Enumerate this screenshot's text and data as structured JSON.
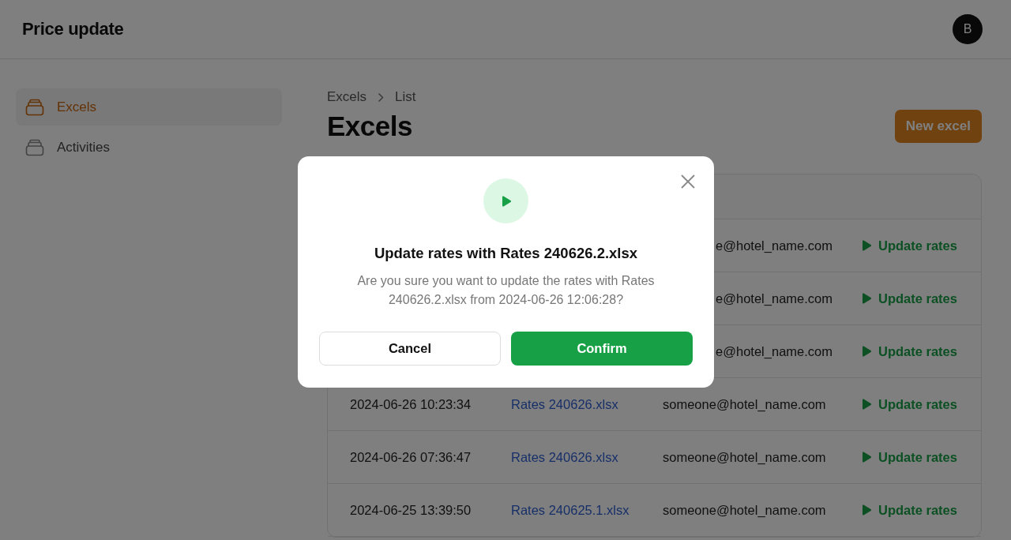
{
  "header": {
    "title": "Price update",
    "avatar": "B"
  },
  "sidebar": {
    "items": [
      {
        "label": "Excels",
        "selected": true
      },
      {
        "label": "Activities",
        "selected": false
      }
    ]
  },
  "breadcrumb": [
    "Excels",
    "List"
  ],
  "page": {
    "title": "Excels",
    "new_button": "New excel"
  },
  "table": {
    "rows": [
      {
        "kind": "covered",
        "email": "e@hotel_name.com",
        "action": "Update rates"
      },
      {
        "kind": "covered",
        "email": "e@hotel_name.com",
        "action": "Update rates"
      },
      {
        "kind": "covered",
        "email": "e@hotel_name.com",
        "action": "Update rates"
      },
      {
        "kind": "full",
        "date": "2024-06-26 10:23:34",
        "file": "Rates 240626.xlsx",
        "email": "someone@hotel_name.com",
        "action": "Update rates"
      },
      {
        "kind": "full",
        "date": "2024-06-26 07:36:47",
        "file": "Rates 240626.xlsx",
        "email": "someone@hotel_name.com",
        "action": "Update rates"
      },
      {
        "kind": "full",
        "date": "2024-06-25 13:39:50",
        "file": "Rates 240625.1.xlsx",
        "email": "someone@hotel_name.com",
        "action": "Update rates"
      }
    ]
  },
  "dialog": {
    "title": "Update rates with Rates 240626.2.xlsx",
    "message": "Are you sure you want to update the rates with Rates 240626.2.xlsx from 2024-06-26 12:06:28?",
    "cancel": "Cancel",
    "confirm": "Confirm"
  }
}
